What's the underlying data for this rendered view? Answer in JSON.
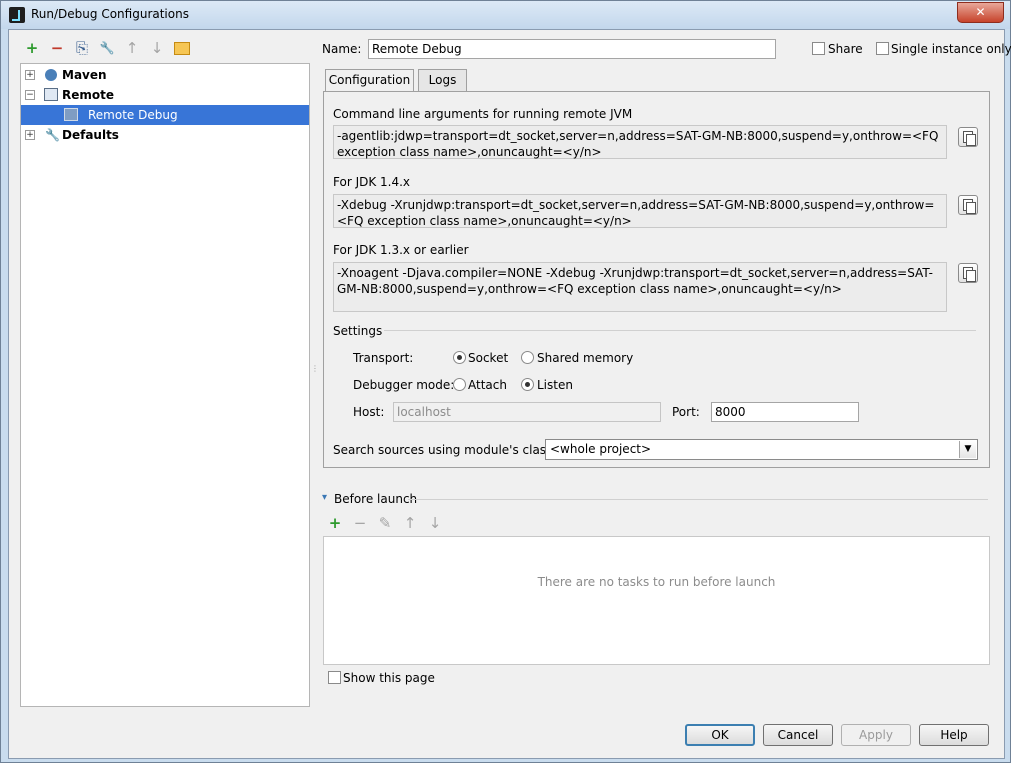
{
  "window": {
    "title": "Run/Debug Configurations",
    "close": "✕"
  },
  "toolbar": {
    "add": "+",
    "remove": "−",
    "copy": "⎘",
    "edit_defaults": "🔧",
    "move_up": "↑",
    "move_down": "↓",
    "folder": "▭",
    "colors": {
      "add": "#2e9a2e",
      "remove": "#c0392b",
      "disabled": "#a5a5a5"
    }
  },
  "tree": {
    "items": [
      {
        "label": "Maven",
        "expander": "+",
        "icon": "gear-icon"
      },
      {
        "label": "Remote",
        "expander": "−",
        "icon": "remote-icon"
      },
      {
        "label": "Remote Debug",
        "icon": "remote-config-icon",
        "selected": true
      },
      {
        "label": "Defaults",
        "expander": "+",
        "icon": "wrench-icon"
      }
    ],
    "selection_color": "#3875d7"
  },
  "header": {
    "name_label": "Name:",
    "name_value": "Remote Debug",
    "share_label": "Share",
    "single_instance_label": "Single instance only"
  },
  "tabs": [
    {
      "label": "Configuration",
      "active": true
    },
    {
      "label": "Logs",
      "active": false
    }
  ],
  "config": {
    "cmd_label": "Command line arguments for running remote JVM",
    "cmd_value": "-agentlib:jdwp=transport=dt_socket,server=n,address=SAT-GM-NB:8000,suspend=y,onthrow=<FQ exception class name>,onuncaught=<y/n>",
    "jdk14_label": "For JDK 1.4.x",
    "jdk14_value": "-Xdebug -Xrunjdwp:transport=dt_socket,server=n,address=SAT-GM-NB:8000,suspend=y,onthrow=<FQ exception class name>,onuncaught=<y/n>",
    "jdk13_label": "For JDK 1.3.x or earlier",
    "jdk13_value": "-Xnoagent -Djava.compiler=NONE -Xdebug -Xrunjdwp:transport=dt_socket,server=n,address=SAT-GM-NB:8000,suspend=y,onthrow=<FQ exception class name>,onuncaught=<y/n>",
    "settings_label": "Settings",
    "transport_label": "Transport:",
    "transport_socket": "Socket",
    "transport_shared": "Shared memory",
    "transport_selected": "Socket",
    "debugger_mode_label": "Debugger mode:",
    "mode_attach": "Attach",
    "mode_listen": "Listen",
    "mode_selected": "Listen",
    "host_label": "Host:",
    "host_value": "localhost",
    "port_label": "Port:",
    "port_value": "8000",
    "search_label": "Search sources using module's classpath:",
    "search_value": "<whole project>",
    "dropdown_arrow": "▼"
  },
  "before_launch": {
    "label": "Before launch",
    "collapse_arrow": "▾",
    "add": "+",
    "remove": "−",
    "edit": "✎",
    "up": "↑",
    "down": "↓",
    "empty_message": "There are no tasks to run before launch",
    "show_page_label": "Show this page"
  },
  "buttons": {
    "ok": "OK",
    "cancel": "Cancel",
    "apply": "Apply",
    "help": "Help"
  }
}
